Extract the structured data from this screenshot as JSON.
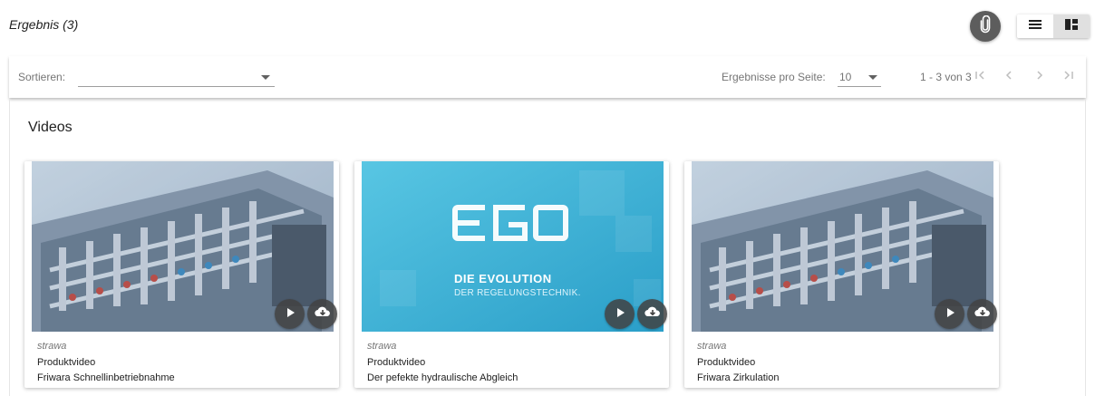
{
  "header": {
    "result_title": "Ergebnis (3)"
  },
  "toolbar": {
    "sort_label": "Sortieren:",
    "sort_value": "",
    "per_page_label": "Ergebnisse pro Seite:",
    "per_page_value": "10",
    "range_label": "1 - 3 von 3"
  },
  "section": {
    "title": "Videos"
  },
  "cards": [
    {
      "brand": "strawa",
      "type": "Produktvideo",
      "name": "Friwara Schnellinbetriebnahme",
      "thumbnail": "manifold-photo"
    },
    {
      "brand": "strawa",
      "type": "Produktvideo",
      "name": "Der pefekte hydraulische Abgleich",
      "thumbnail": "ego-logo",
      "thumb_logo": "ego",
      "thumb_title": "DIE EVOLUTION",
      "thumb_subtitle": "DER REGELUNGSTECHNIK."
    },
    {
      "brand": "strawa",
      "type": "Produktvideo",
      "name": "Friwara Zirkulation",
      "thumbnail": "manifold-photo"
    }
  ],
  "icons": {
    "attach": "paperclip-icon",
    "list_view": "list-view-icon",
    "grid_view": "grid-view-icon",
    "play": "play-icon",
    "download": "cloud-download-icon"
  },
  "colors": {
    "attach_button": "#5d5d5d",
    "ego_background": "#3fb6d8",
    "card_button": "#424242"
  }
}
